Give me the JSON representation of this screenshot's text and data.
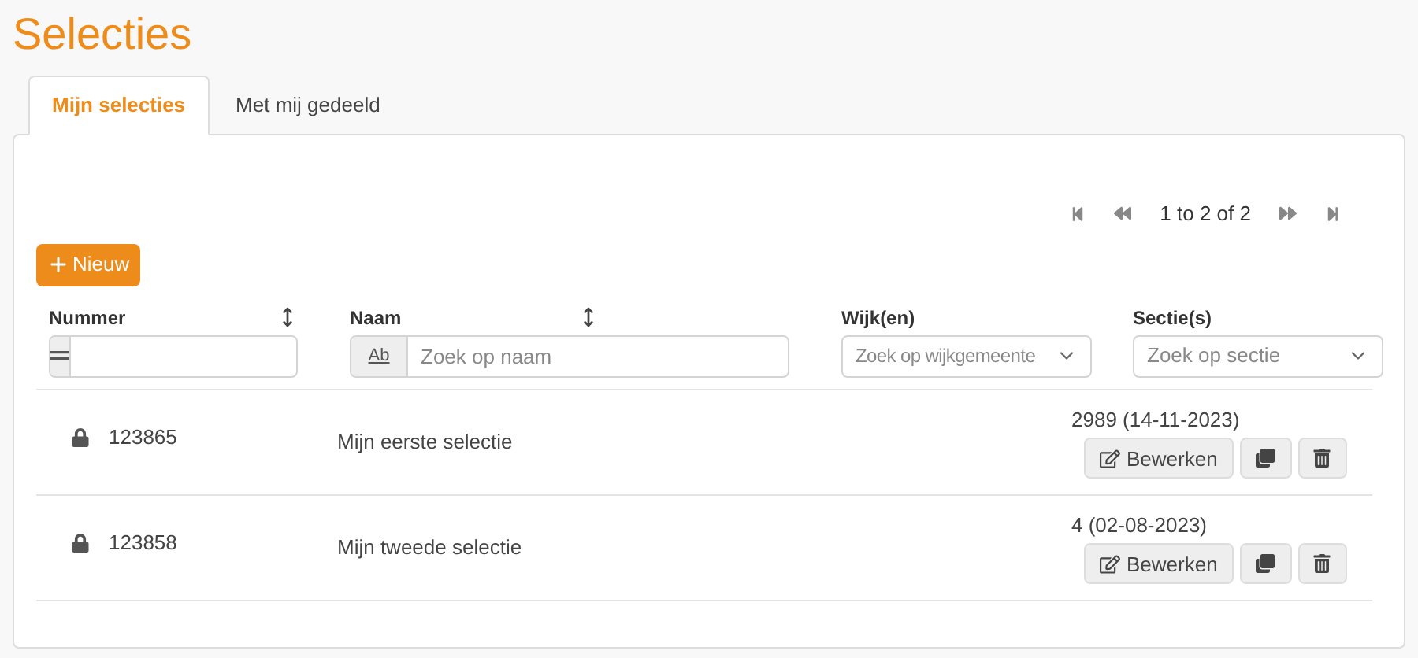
{
  "title": "Selecties",
  "tabs": [
    {
      "label": "Mijn selecties",
      "selected": true
    },
    {
      "label": "Met mij gedeeld",
      "selected": false
    }
  ],
  "pagination": {
    "summary": "1 to 2 of 2"
  },
  "new_button": "Nieuw",
  "columns": [
    {
      "label": "Nummer",
      "sortable": true,
      "filter": {
        "kind": "number"
      }
    },
    {
      "label": "Naam",
      "sortable": true,
      "filter": {
        "kind": "text",
        "prefix": "Ab",
        "placeholder": "Zoek op naam"
      }
    },
    {
      "label": "Wijk(en)",
      "sortable": false,
      "filter": {
        "kind": "select",
        "placeholder": "Zoek op wijkgemeente"
      }
    },
    {
      "label": "Sectie(s)",
      "sortable": false,
      "filter": {
        "kind": "select",
        "placeholder": "Zoek op sectie"
      }
    }
  ],
  "rows": [
    {
      "locked": true,
      "number": "123865",
      "name": "Mijn eerste selectie",
      "sectie": "2989 (14-11-2023)",
      "edit": "Bewerken"
    },
    {
      "locked": true,
      "number": "123858",
      "name": "Mijn tweede selectie",
      "sectie": "4 (02-08-2023)",
      "edit": "Bewerken"
    }
  ]
}
